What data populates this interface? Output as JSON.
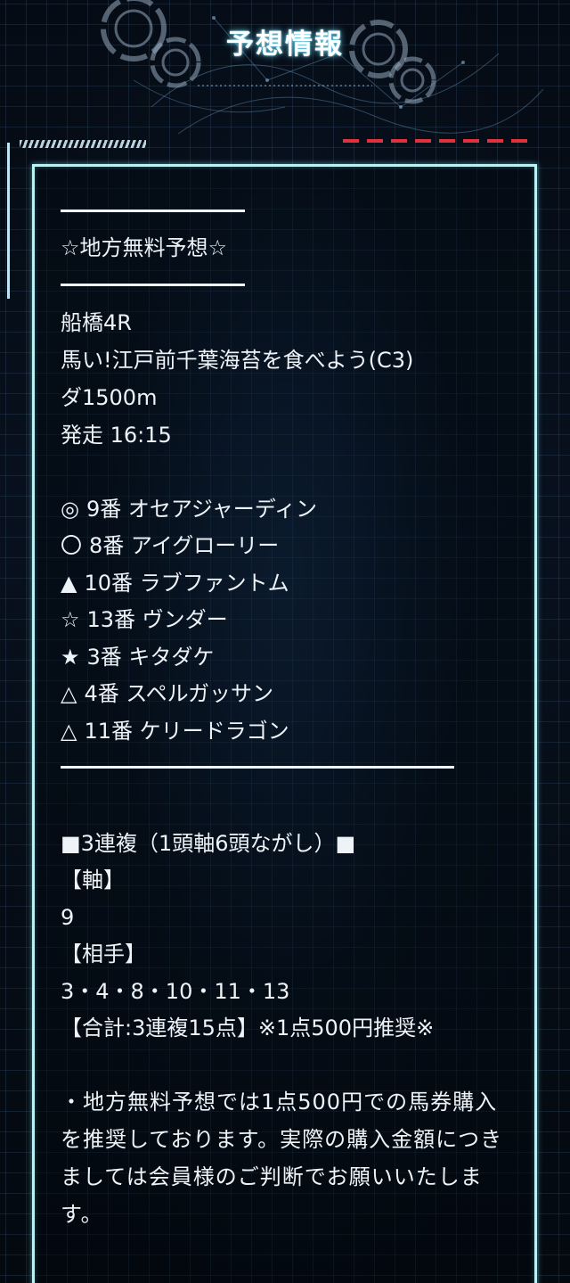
{
  "header": {
    "title": "予想情報"
  },
  "section": {
    "heading": "☆地方無料予想☆"
  },
  "race": {
    "venue_race": "船橋4R",
    "race_name": "馬い!江戸前千葉海苔を食べよう(C3)",
    "distance": "ダ1500m",
    "start_time": "発走 16:15"
  },
  "picks": [
    {
      "mark": "◎",
      "text": "9番 オセアジャーディン"
    },
    {
      "mark": "〇",
      "text": "8番 アイグローリー"
    },
    {
      "mark": "▲",
      "text": "10番 ラブファントム"
    },
    {
      "mark": "☆",
      "text": "13番 ヴンダー"
    },
    {
      "mark": "★",
      "text": "3番 キタダケ"
    },
    {
      "mark": "△",
      "text": "4番 スペルガッサン"
    },
    {
      "mark": "△",
      "text": "11番 ケリードラゴン"
    }
  ],
  "bet": {
    "type_line": "■3連複（1頭軸6頭ながし）■",
    "axis_label": "【軸】",
    "axis_value": "9",
    "partner_label": "【相手】",
    "partner_value": "3・4・8・10・11・13",
    "total_line": "【合計:3連複15点】※1点500円推奨※"
  },
  "notice": {
    "text": "・地方無料予想では1点500円での馬券購入を推奨しております。実際の購入金額につきましては会員様のご判断でお願いいたします。"
  },
  "colors": {
    "accent_cyan": "#b9f1f4",
    "accent_red": "#e0323c",
    "background": "#050b14"
  }
}
